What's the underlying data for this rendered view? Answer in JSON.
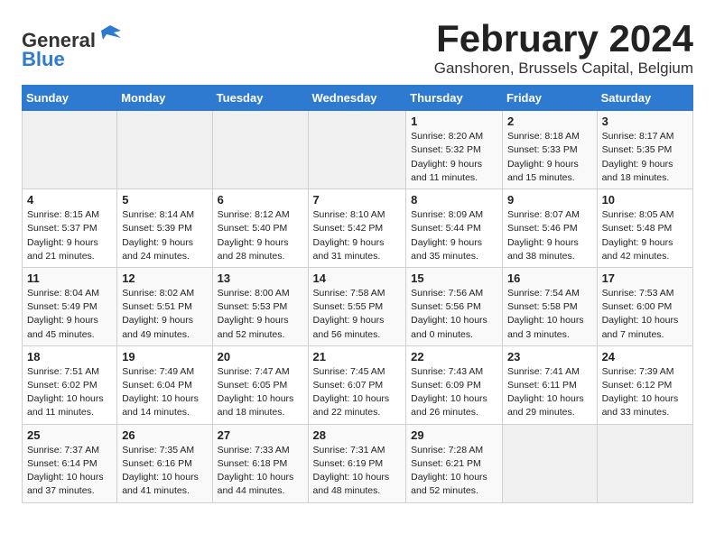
{
  "header": {
    "logo_line1": "General",
    "logo_line2": "Blue",
    "month_title": "February 2024",
    "location": "Ganshoren, Brussels Capital, Belgium"
  },
  "days_of_week": [
    "Sunday",
    "Monday",
    "Tuesday",
    "Wednesday",
    "Thursday",
    "Friday",
    "Saturday"
  ],
  "weeks": [
    [
      {
        "day": "",
        "info": ""
      },
      {
        "day": "",
        "info": ""
      },
      {
        "day": "",
        "info": ""
      },
      {
        "day": "",
        "info": ""
      },
      {
        "day": "1",
        "info": "Sunrise: 8:20 AM\nSunset: 5:32 PM\nDaylight: 9 hours\nand 11 minutes."
      },
      {
        "day": "2",
        "info": "Sunrise: 8:18 AM\nSunset: 5:33 PM\nDaylight: 9 hours\nand 15 minutes."
      },
      {
        "day": "3",
        "info": "Sunrise: 8:17 AM\nSunset: 5:35 PM\nDaylight: 9 hours\nand 18 minutes."
      }
    ],
    [
      {
        "day": "4",
        "info": "Sunrise: 8:15 AM\nSunset: 5:37 PM\nDaylight: 9 hours\nand 21 minutes."
      },
      {
        "day": "5",
        "info": "Sunrise: 8:14 AM\nSunset: 5:39 PM\nDaylight: 9 hours\nand 24 minutes."
      },
      {
        "day": "6",
        "info": "Sunrise: 8:12 AM\nSunset: 5:40 PM\nDaylight: 9 hours\nand 28 minutes."
      },
      {
        "day": "7",
        "info": "Sunrise: 8:10 AM\nSunset: 5:42 PM\nDaylight: 9 hours\nand 31 minutes."
      },
      {
        "day": "8",
        "info": "Sunrise: 8:09 AM\nSunset: 5:44 PM\nDaylight: 9 hours\nand 35 minutes."
      },
      {
        "day": "9",
        "info": "Sunrise: 8:07 AM\nSunset: 5:46 PM\nDaylight: 9 hours\nand 38 minutes."
      },
      {
        "day": "10",
        "info": "Sunrise: 8:05 AM\nSunset: 5:48 PM\nDaylight: 9 hours\nand 42 minutes."
      }
    ],
    [
      {
        "day": "11",
        "info": "Sunrise: 8:04 AM\nSunset: 5:49 PM\nDaylight: 9 hours\nand 45 minutes."
      },
      {
        "day": "12",
        "info": "Sunrise: 8:02 AM\nSunset: 5:51 PM\nDaylight: 9 hours\nand 49 minutes."
      },
      {
        "day": "13",
        "info": "Sunrise: 8:00 AM\nSunset: 5:53 PM\nDaylight: 9 hours\nand 52 minutes."
      },
      {
        "day": "14",
        "info": "Sunrise: 7:58 AM\nSunset: 5:55 PM\nDaylight: 9 hours\nand 56 minutes."
      },
      {
        "day": "15",
        "info": "Sunrise: 7:56 AM\nSunset: 5:56 PM\nDaylight: 10 hours\nand 0 minutes."
      },
      {
        "day": "16",
        "info": "Sunrise: 7:54 AM\nSunset: 5:58 PM\nDaylight: 10 hours\nand 3 minutes."
      },
      {
        "day": "17",
        "info": "Sunrise: 7:53 AM\nSunset: 6:00 PM\nDaylight: 10 hours\nand 7 minutes."
      }
    ],
    [
      {
        "day": "18",
        "info": "Sunrise: 7:51 AM\nSunset: 6:02 PM\nDaylight: 10 hours\nand 11 minutes."
      },
      {
        "day": "19",
        "info": "Sunrise: 7:49 AM\nSunset: 6:04 PM\nDaylight: 10 hours\nand 14 minutes."
      },
      {
        "day": "20",
        "info": "Sunrise: 7:47 AM\nSunset: 6:05 PM\nDaylight: 10 hours\nand 18 minutes."
      },
      {
        "day": "21",
        "info": "Sunrise: 7:45 AM\nSunset: 6:07 PM\nDaylight: 10 hours\nand 22 minutes."
      },
      {
        "day": "22",
        "info": "Sunrise: 7:43 AM\nSunset: 6:09 PM\nDaylight: 10 hours\nand 26 minutes."
      },
      {
        "day": "23",
        "info": "Sunrise: 7:41 AM\nSunset: 6:11 PM\nDaylight: 10 hours\nand 29 minutes."
      },
      {
        "day": "24",
        "info": "Sunrise: 7:39 AM\nSunset: 6:12 PM\nDaylight: 10 hours\nand 33 minutes."
      }
    ],
    [
      {
        "day": "25",
        "info": "Sunrise: 7:37 AM\nSunset: 6:14 PM\nDaylight: 10 hours\nand 37 minutes."
      },
      {
        "day": "26",
        "info": "Sunrise: 7:35 AM\nSunset: 6:16 PM\nDaylight: 10 hours\nand 41 minutes."
      },
      {
        "day": "27",
        "info": "Sunrise: 7:33 AM\nSunset: 6:18 PM\nDaylight: 10 hours\nand 44 minutes."
      },
      {
        "day": "28",
        "info": "Sunrise: 7:31 AM\nSunset: 6:19 PM\nDaylight: 10 hours\nand 48 minutes."
      },
      {
        "day": "29",
        "info": "Sunrise: 7:28 AM\nSunset: 6:21 PM\nDaylight: 10 hours\nand 52 minutes."
      },
      {
        "day": "",
        "info": ""
      },
      {
        "day": "",
        "info": ""
      }
    ]
  ]
}
